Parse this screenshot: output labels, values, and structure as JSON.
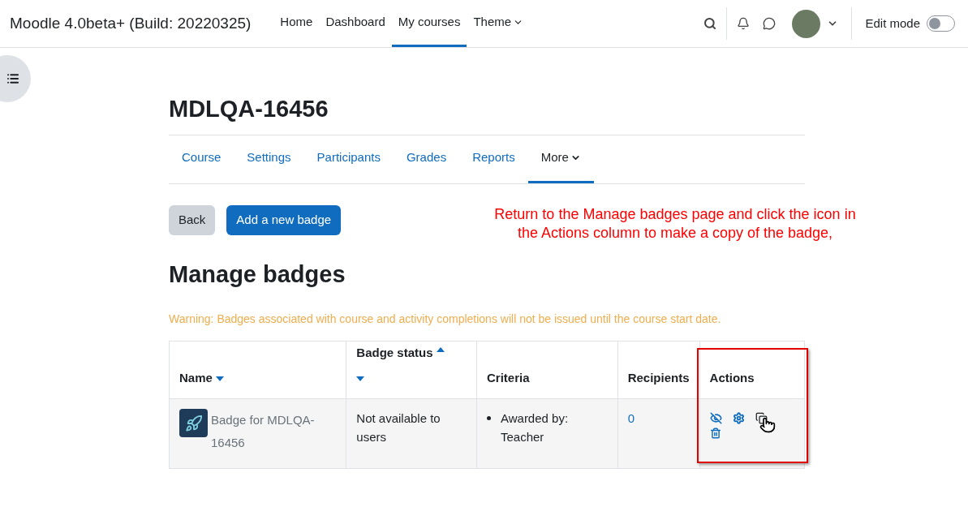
{
  "site_title": "Moodle 4.0beta+ (Build: 20220325)",
  "nav": [
    {
      "label": "Home",
      "selected": false,
      "dropdown": false
    },
    {
      "label": "Dashboard",
      "selected": false,
      "dropdown": false
    },
    {
      "label": "My courses",
      "selected": true,
      "dropdown": false
    },
    {
      "label": "Theme",
      "selected": false,
      "dropdown": true
    }
  ],
  "edit_mode": {
    "label": "Edit mode",
    "on": false
  },
  "course_title": "MDLQA-16456",
  "course_tabs": [
    {
      "label": "Course",
      "selected": false,
      "dropdown": false
    },
    {
      "label": "Settings",
      "selected": false,
      "dropdown": false
    },
    {
      "label": "Participants",
      "selected": false,
      "dropdown": false
    },
    {
      "label": "Grades",
      "selected": false,
      "dropdown": false
    },
    {
      "label": "Reports",
      "selected": false,
      "dropdown": false
    },
    {
      "label": "More",
      "selected": true,
      "dropdown": true
    }
  ],
  "buttons": [
    {
      "label": "Back",
      "kind": "secondary"
    },
    {
      "label": "Add a new badge",
      "kind": "primary"
    }
  ],
  "annotation": "Return to the Manage badges page and click the icon in the Actions column to make a copy of the badge,",
  "heading": "Manage badges",
  "warning": "Warning: Badges associated with course and activity completions will not be issued until the course start date.",
  "table": {
    "columns": [
      {
        "label": "Name",
        "sort_down": true
      },
      {
        "label": "Badge status",
        "sort_up": true,
        "sort_down": true
      },
      {
        "label": "Criteria"
      },
      {
        "label": "Recipients"
      },
      {
        "label": "Actions"
      }
    ],
    "rows": [
      {
        "name": "Badge for MDLQA-16456",
        "status": "Not available to users",
        "criteria": [
          "Awarded by: Teacher"
        ],
        "recipients": "0"
      }
    ]
  }
}
